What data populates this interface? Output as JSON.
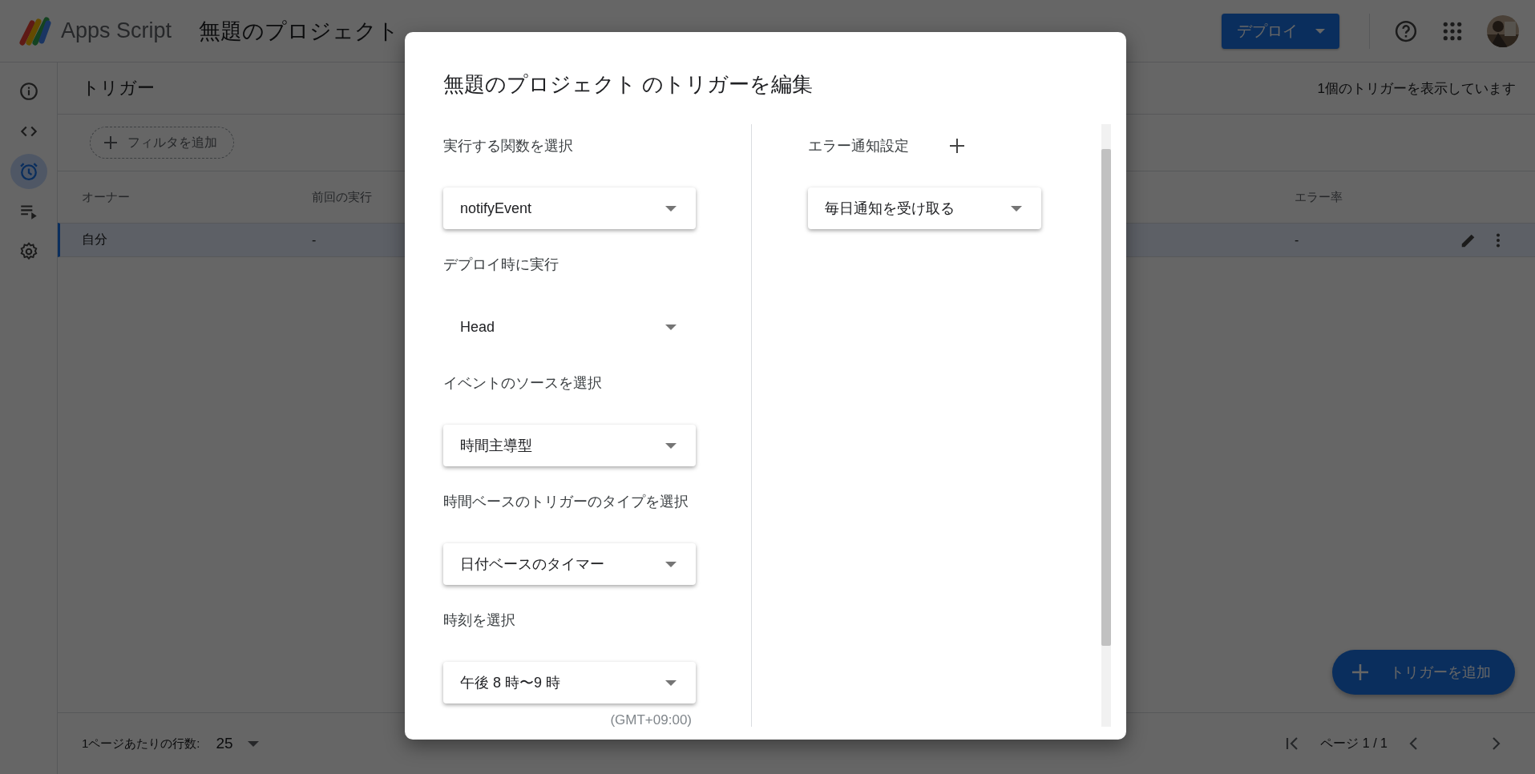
{
  "header": {
    "product": "Apps Script",
    "project_title": "無題のプロジェクト",
    "deploy_button": "デプロイ"
  },
  "sidebar": {
    "items": [
      {
        "kind": "info",
        "selected": false
      },
      {
        "kind": "code",
        "selected": false
      },
      {
        "kind": "clock",
        "selected": true
      },
      {
        "kind": "list",
        "selected": false
      },
      {
        "kind": "gear",
        "selected": false
      }
    ]
  },
  "page": {
    "title": "トリガー",
    "count": "1個のトリガーを表示しています",
    "filter_chip": "フィルタを追加"
  },
  "table": {
    "columns": [
      "オーナー",
      "前回の実行",
      "エラー率"
    ],
    "rows": [
      {
        "cells": [
          "自分",
          "-",
          "-"
        ],
        "selected": true
      }
    ]
  },
  "footer": {
    "rows_label": "1ページあたりの行数:",
    "rows_value": "25",
    "page": "ページ 1 / 1"
  },
  "fab": "トリガーを追加",
  "dialog": {
    "title": "無題のプロジェクト のトリガーを編集",
    "sections": [
      {
        "label": "実行する関数を選択",
        "value": "notifyEvent",
        "kind": "raised"
      },
      {
        "label": "デプロイ時に実行",
        "value": "Head",
        "kind": "plain"
      },
      {
        "label": "イベントのソースを選択",
        "value": "時間主導型",
        "kind": "raised"
      },
      {
        "label": "時間ベースのトリガーのタイプを選択",
        "value": "日付ベースのタイマー",
        "kind": "raised"
      },
      {
        "label": "時刻を選択",
        "value": "午後 8 時〜9 時",
        "kind": "raised"
      }
    ],
    "timezone": "(GMT+09:00)",
    "notification": {
      "label": "エラー通知設定",
      "value": "毎日通知を受け取る"
    }
  }
}
